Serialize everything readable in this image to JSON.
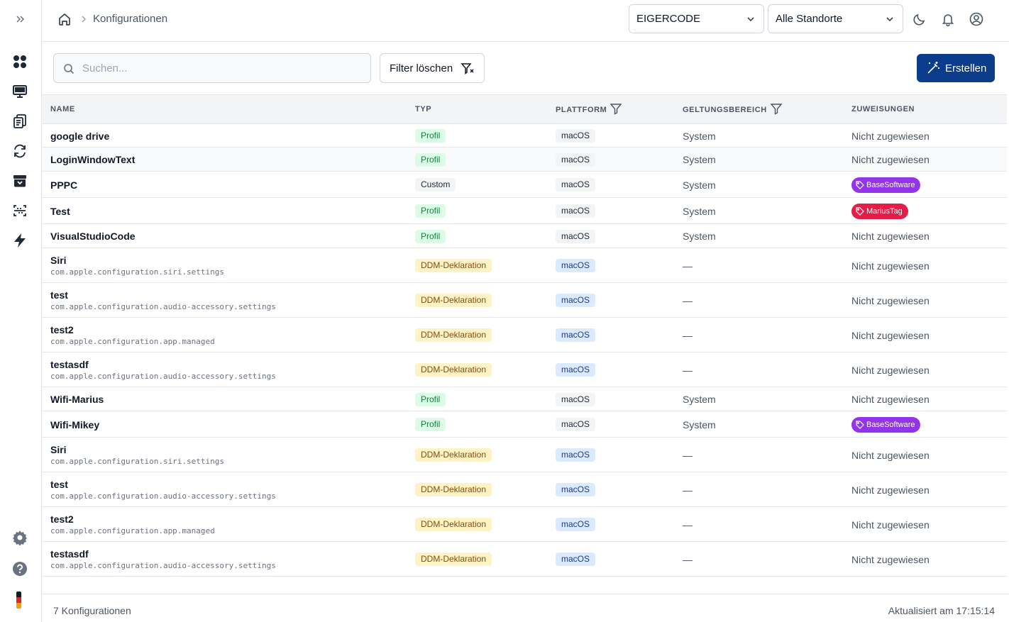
{
  "breadcrumb": {
    "current": "Konfigurationen"
  },
  "header": {
    "org_select": "EIGERCODE",
    "location_select": "Alle Standorte"
  },
  "toolbar": {
    "search_placeholder": "Suchen...",
    "clear_filter_label": "Filter löschen",
    "create_label": "Erstellen"
  },
  "table": {
    "columns": [
      "NAME",
      "TYP",
      "PLATTFORM",
      "GELTUNGSBEREICH",
      "ZUWEISUNGEN"
    ],
    "rows": [
      {
        "name": "google drive",
        "sub": "",
        "type": "Profil",
        "platform": "macOS",
        "scope": "System",
        "assignment": "Nicht zugewiesen",
        "tag": ""
      },
      {
        "name": "LoginWindowText",
        "sub": "",
        "type": "Profil",
        "platform": "macOS",
        "scope": "System",
        "assignment": "Nicht zugewiesen",
        "tag": ""
      },
      {
        "name": "PPPC",
        "sub": "",
        "type": "Custom",
        "platform": "macOS",
        "scope": "System",
        "assignment": "",
        "tag": "BaseSoftware"
      },
      {
        "name": "Test",
        "sub": "",
        "type": "Profil",
        "platform": "macOS",
        "scope": "System",
        "assignment": "",
        "tag": "MariusTag"
      },
      {
        "name": "VisualStudioCode",
        "sub": "",
        "type": "Profil",
        "platform": "macOS",
        "scope": "System",
        "assignment": "Nicht zugewiesen",
        "tag": ""
      },
      {
        "name": "Siri",
        "sub": "com.apple.configuration.siri.settings",
        "type": "DDM-Deklaration",
        "platform": "macOS",
        "scope": "—",
        "assignment": "Nicht zugewiesen",
        "tag": ""
      },
      {
        "name": "test",
        "sub": "com.apple.configuration.audio-accessory.settings",
        "type": "DDM-Deklaration",
        "platform": "macOS",
        "scope": "—",
        "assignment": "Nicht zugewiesen",
        "tag": ""
      },
      {
        "name": "test2",
        "sub": "com.apple.configuration.app.managed",
        "type": "DDM-Deklaration",
        "platform": "macOS",
        "scope": "—",
        "assignment": "Nicht zugewiesen",
        "tag": ""
      },
      {
        "name": "testasdf",
        "sub": "com.apple.configuration.audio-accessory.settings",
        "type": "DDM-Deklaration",
        "platform": "macOS",
        "scope": "—",
        "assignment": "Nicht zugewiesen",
        "tag": ""
      },
      {
        "name": "Wifi-Marius",
        "sub": "",
        "type": "Profil",
        "platform": "macOS",
        "scope": "System",
        "assignment": "Nicht zugewiesen",
        "tag": ""
      },
      {
        "name": "Wifi-Mikey",
        "sub": "",
        "type": "Profil",
        "platform": "macOS",
        "scope": "System",
        "assignment": "",
        "tag": "BaseSoftware"
      },
      {
        "name": "Siri",
        "sub": "com.apple.configuration.siri.settings",
        "type": "DDM-Deklaration",
        "platform": "macOS",
        "scope": "—",
        "assignment": "Nicht zugewiesen",
        "tag": ""
      },
      {
        "name": "test",
        "sub": "com.apple.configuration.audio-accessory.settings",
        "type": "DDM-Deklaration",
        "platform": "macOS",
        "scope": "—",
        "assignment": "Nicht zugewiesen",
        "tag": ""
      },
      {
        "name": "test2",
        "sub": "com.apple.configuration.app.managed",
        "type": "DDM-Deklaration",
        "platform": "macOS",
        "scope": "—",
        "assignment": "Nicht zugewiesen",
        "tag": ""
      },
      {
        "name": "testasdf",
        "sub": "com.apple.configuration.audio-accessory.settings",
        "type": "DDM-Deklaration",
        "platform": "macOS",
        "scope": "—",
        "assignment": "Nicht zugewiesen",
        "tag": ""
      }
    ]
  },
  "tag_colors": {
    "BaseSoftware": "#9333ea",
    "MariusTag": "#e11d48"
  },
  "accent_color": "#0c3c8c",
  "footer": {
    "count": "7 Konfigurationen",
    "updated": "Aktualisiert am 17:15:14"
  },
  "icons": {
    "sidebar": [
      "expand-icon",
      "dashboard-icon",
      "monitor-icon",
      "documents-icon",
      "sync-icon",
      "archive-icon",
      "scan-icon",
      "lightning-icon",
      "settings-icon",
      "help-icon",
      "flag-de-icon"
    ],
    "topbar": [
      "home-icon",
      "moon-icon",
      "bell-icon",
      "user-circle-icon"
    ]
  }
}
